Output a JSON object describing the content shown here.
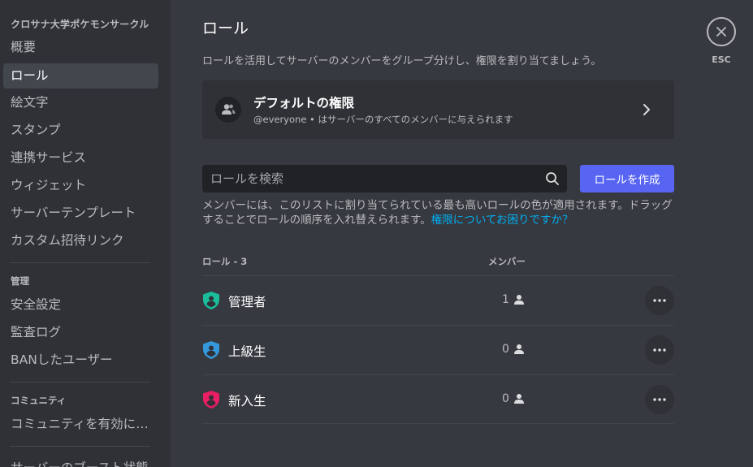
{
  "sidebar": {
    "server_name": "クロサナ大学ポケモンサークル",
    "items": [
      {
        "label": "概要"
      },
      {
        "label": "ロール",
        "active": true
      },
      {
        "label": "絵文字"
      },
      {
        "label": "スタンプ"
      },
      {
        "label": "連携サービス"
      },
      {
        "label": "ウィジェット"
      },
      {
        "label": "サーバーテンプレート"
      },
      {
        "label": "カスタム招待リンク"
      }
    ],
    "section_manage": "管理",
    "manage_items": [
      {
        "label": "安全設定"
      },
      {
        "label": "監査ログ"
      },
      {
        "label": "BANしたユーザー"
      }
    ],
    "section_community": "コミュニティ",
    "community_items": [
      {
        "label": "コミュニティを有効にする"
      }
    ],
    "cut_item": "サーバーのブースト状態"
  },
  "main": {
    "title": "ロール",
    "description": "ロールを活用してサーバーのメンバーをグループ分けし、権限を割り当てましょう。",
    "default_perms": {
      "title": "デフォルトの権限",
      "subtitle": "@everyone • はサーバーのすべてのメンバーに与えられます"
    },
    "search": {
      "placeholder": "ロールを検索"
    },
    "create_label": "ロールを作成",
    "hint_text": "メンバーには、このリストに割り当てられている最も高いロールの色が適用されます。ドラッグすることでロールの順序を入れ替えられます。",
    "hint_link": "権限についてお困りですか？",
    "table": {
      "roles_header": "ロール - 3",
      "members_header": "メンバー",
      "rows": [
        {
          "name": "管理者",
          "count": "1",
          "color": "#1abc9c"
        },
        {
          "name": "上級生",
          "count": "0",
          "color": "#3498db"
        },
        {
          "name": "新入生",
          "count": "0",
          "color": "#e91e63"
        }
      ]
    }
  },
  "close": {
    "label": "ESC"
  },
  "icons": {
    "default_perms": "users-icon",
    "chevron": "chevron-right-icon",
    "search": "search-icon",
    "role": "shield-user-icon",
    "member": "person-icon",
    "more": "more-horizontal-icon",
    "close": "close-icon"
  }
}
